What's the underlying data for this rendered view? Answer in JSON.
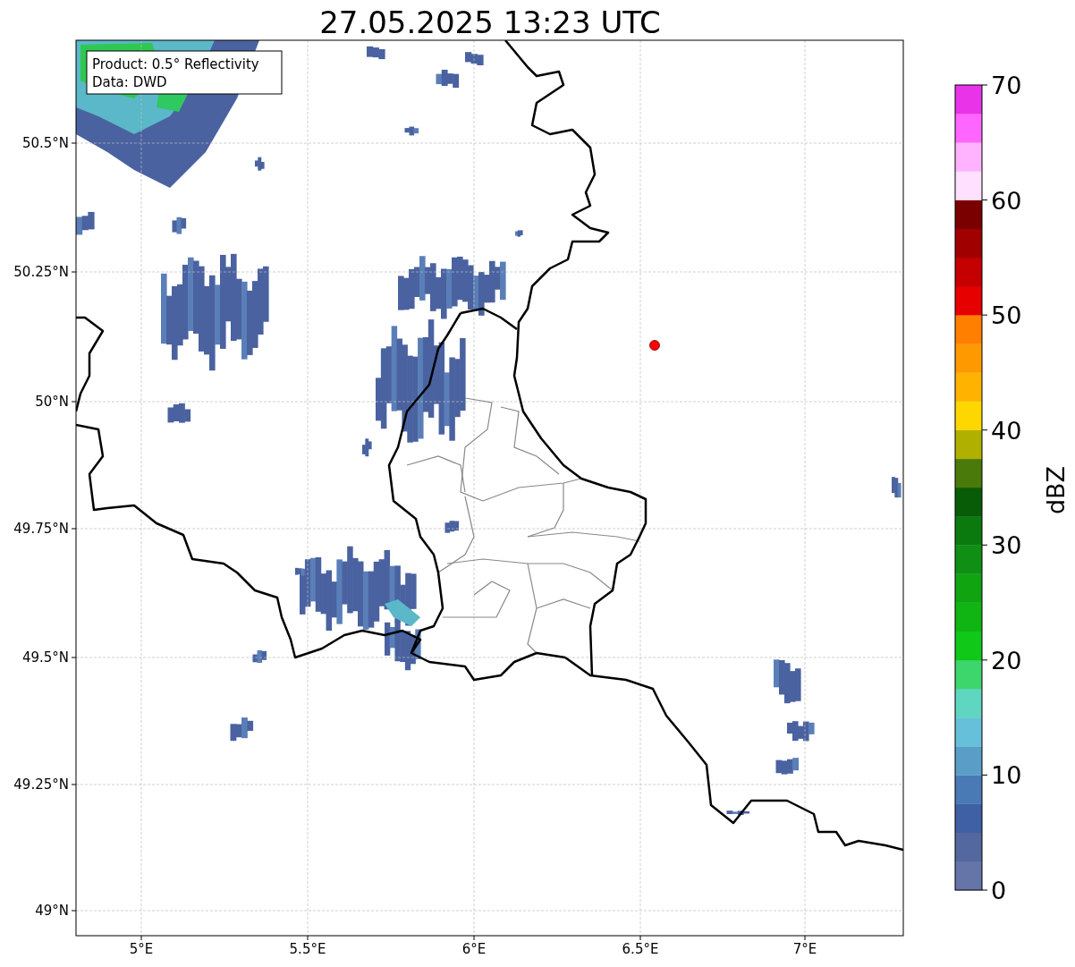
{
  "title": "27.05.2025 13:23 UTC",
  "legend": [
    "Product: 0.5° Reflectivity",
    "Data: DWD"
  ],
  "x_ticks": [
    "5°E",
    "5.5°E",
    "6°E",
    "6.5°E",
    "7°E"
  ],
  "y_ticks": [
    "50.5°N",
    "50.25°N",
    "50°N",
    "49.75°N",
    "49.5°N",
    "49.25°N",
    "49°N"
  ],
  "colorbar": {
    "label": "dBZ",
    "ticks": [
      "70",
      "60",
      "50",
      "40",
      "30",
      "20",
      "10",
      "0"
    ],
    "segments": [
      {
        "color": "#6675a8"
      },
      {
        "color": "#5468a0"
      },
      {
        "color": "#4060a6"
      },
      {
        "color": "#4a7ab5"
      },
      {
        "color": "#5a9ec8"
      },
      {
        "color": "#66c0d9"
      },
      {
        "color": "#5fd6c0"
      },
      {
        "color": "#3dd66d"
      },
      {
        "color": "#10c818"
      },
      {
        "color": "#10b514"
      },
      {
        "color": "#10a510"
      },
      {
        "color": "#0f8f14"
      },
      {
        "color": "#0a7a0f"
      },
      {
        "color": "#085c08"
      },
      {
        "color": "#4a7a0a"
      },
      {
        "color": "#b0b000"
      },
      {
        "color": "#ffd700"
      },
      {
        "color": "#ffb300"
      },
      {
        "color": "#ff9900"
      },
      {
        "color": "#ff7f00"
      },
      {
        "color": "#e60000"
      },
      {
        "color": "#c40000"
      },
      {
        "color": "#a00000"
      },
      {
        "color": "#7a0000"
      },
      {
        "color": "#ffe0ff"
      },
      {
        "color": "#ffb3ff"
      },
      {
        "color": "#ff66ff"
      },
      {
        "color": "#e833e8"
      }
    ]
  }
}
